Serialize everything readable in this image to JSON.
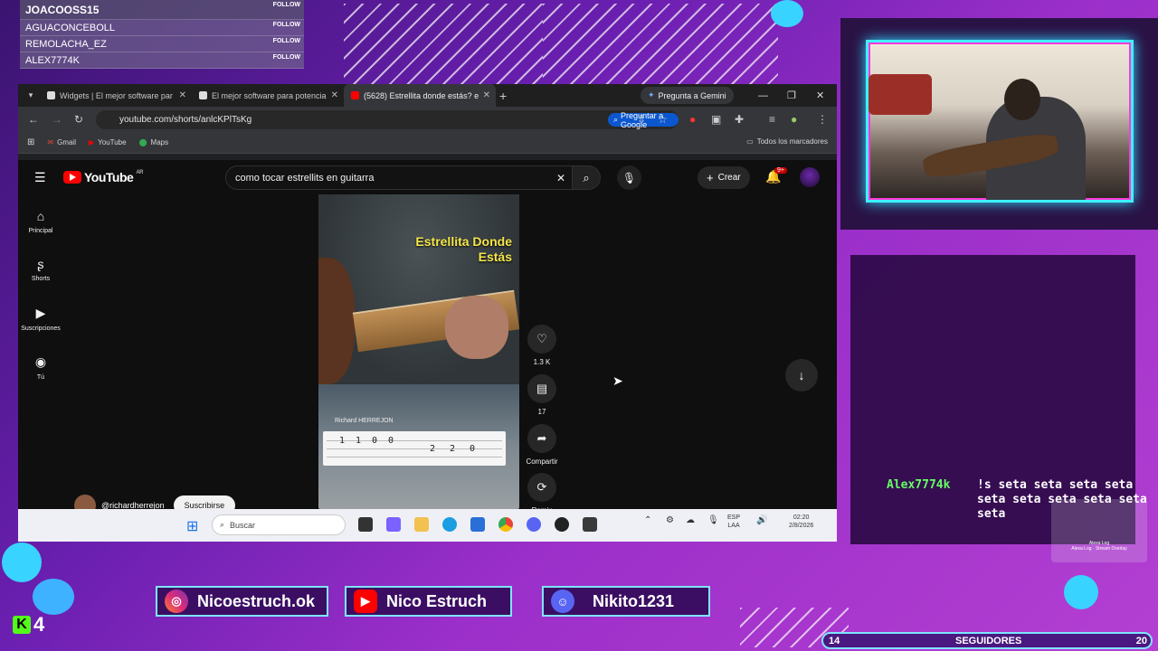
{
  "followers": [
    {
      "name": "JOACOOSS15",
      "action": "FOLLOW"
    },
    {
      "name": "AGUACONCEBOLL",
      "action": "FOLLOW"
    },
    {
      "name": "REMOLACHA_EZ",
      "action": "FOLLOW"
    },
    {
      "name": "ALEX7774K",
      "action": "FOLLOW"
    }
  ],
  "browser": {
    "tabs": [
      {
        "label": "Widgets | El mejor software par"
      },
      {
        "label": "El mejor software para potencia"
      },
      {
        "label": "(5628) Estrellita donde estás? e"
      }
    ],
    "gemini_label": "Pregunta a Gemini",
    "url": "youtube.com/shorts/anlcKPlTsKg",
    "ask_google": "Preguntar a Google",
    "bookmarks": [
      "Gmail",
      "YouTube",
      "Maps"
    ],
    "all_bookmarks": "Todos los marcadores"
  },
  "youtube": {
    "logo": "YouTube",
    "region": "AR",
    "search_value": "como tocar estrellits en guitarra",
    "create_label": "Crear",
    "notif_badge": "9+",
    "sidebar": [
      {
        "label": "Principal",
        "icon": "home-icon"
      },
      {
        "label": "Shorts",
        "icon": "shorts-icon"
      },
      {
        "label": "Suscripciones",
        "icon": "subscriptions-icon"
      },
      {
        "label": "Tú",
        "icon": "user-icon"
      }
    ],
    "short": {
      "title_line1": "Estrellita Donde",
      "title_line2": "Estás",
      "credit": "Richard HERREJON",
      "tab_row1": "1100",
      "tab_row2": "220"
    },
    "actions": {
      "likes": "1.3 K",
      "comments": "17",
      "share": "Compartir",
      "remix": "Remix"
    },
    "channel": "@richardherrejon",
    "subscribe": "Suscribirse"
  },
  "taskbar": {
    "search": "Buscar",
    "lang": "ESP",
    "lang2": "LAA",
    "time": "02:20",
    "date": "2/8/2026"
  },
  "chat": {
    "user": "Alex7774k",
    "message": "!s seta seta seta seta seta seta seta seta seta seta",
    "mini_title": "Alexa Log",
    "mini_sub": "Alexa Log · Stream Overlay"
  },
  "socials": {
    "instagram": "Nicoestruch.ok",
    "youtube": "Nico Estruch",
    "discord": "Nikito1231"
  },
  "kick_count": "4",
  "follower_goal": {
    "current": "14",
    "label": "SEGUIDORES",
    "goal": "20"
  },
  "colors": {
    "accent_cyan": "#3ff0ff",
    "kick_green": "#53fc18",
    "yt_red": "#ff0000"
  }
}
